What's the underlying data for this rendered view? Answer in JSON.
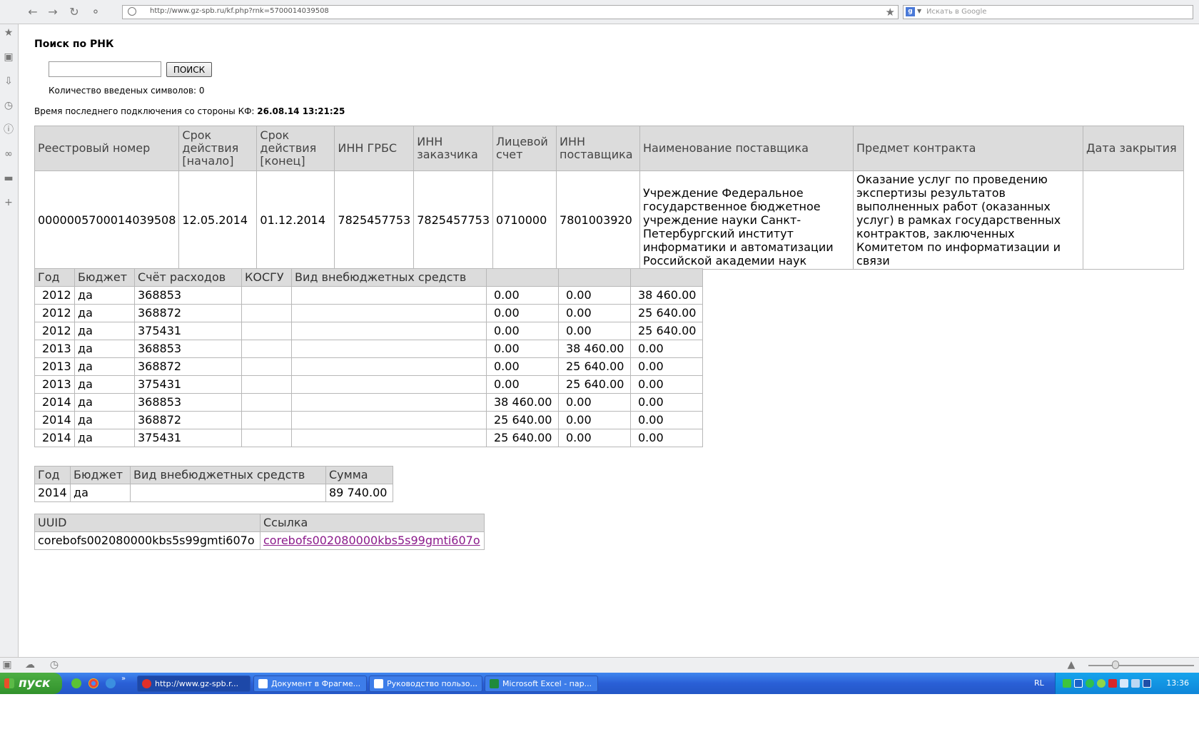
{
  "browser": {
    "url": "http://www.gz-spb.ru/kf.php?rnk=5700014039508",
    "search_placeholder": "Искать в Google",
    "google_icon_letter": "g"
  },
  "page": {
    "title": "Поиск по РНК",
    "search_button": "ПОИСК",
    "rnk_input_value": "",
    "char_count": "Количество введеных символов: 0",
    "last_connection_label": "Время последнего подключения со стороны КФ:",
    "last_connection_value": "26.08.14 13:21:25"
  },
  "contract_table": {
    "headers": [
      "Реестровый номер",
      "Срок действия [начало]",
      "Срок действия [конец]",
      "ИНН ГРБС",
      "ИНН заказчика",
      "Лицевой счет",
      "ИНН поставщика",
      "Наименование поставщика",
      "Предмет контракта",
      "Дата закрытия"
    ],
    "row": [
      "0000005700014039508",
      "12.05.2014",
      "01.12.2014",
      "7825457753",
      "7825457753",
      "0710000",
      "7801003920",
      "Учреждение Федеральное государственное бюджетное учреждение науки Санкт-Петербургский институт информатики и автоматизации Российской академии наук",
      "Оказание услуг по проведению экспертизы результатов выполненных работ (оказанных услуг) в рамках государственных контрактов, заключенных Комитетом по информатизации и связи",
      ""
    ]
  },
  "budget_table": {
    "headers": [
      "Год",
      "Бюджет",
      "Счёт расходов",
      "КОСГУ",
      "Вид внебюджетных средств",
      "",
      "",
      ""
    ],
    "rows": [
      [
        "2012",
        "да",
        "368853",
        "",
        "",
        "0.00",
        "0.00",
        "38 460.00"
      ],
      [
        "2012",
        "да",
        "368872",
        "",
        "",
        "0.00",
        "0.00",
        "25 640.00"
      ],
      [
        "2012",
        "да",
        "375431",
        "",
        "",
        "0.00",
        "0.00",
        "25 640.00"
      ],
      [
        "2013",
        "да",
        "368853",
        "",
        "",
        "0.00",
        "38 460.00",
        "0.00"
      ],
      [
        "2013",
        "да",
        "368872",
        "",
        "",
        "0.00",
        "25 640.00",
        "0.00"
      ],
      [
        "2013",
        "да",
        "375431",
        "",
        "",
        "0.00",
        "25 640.00",
        "0.00"
      ],
      [
        "2014",
        "да",
        "368853",
        "",
        "",
        "38 460.00",
        "0.00",
        "0.00"
      ],
      [
        "2014",
        "да",
        "368872",
        "",
        "",
        "25 640.00",
        "0.00",
        "0.00"
      ],
      [
        "2014",
        "да",
        "375431",
        "",
        "",
        "25 640.00",
        "0.00",
        "0.00"
      ]
    ]
  },
  "sum_table": {
    "headers": [
      "Год",
      "Бюджет",
      "Вид внебюджетных средств",
      "Сумма"
    ],
    "rows": [
      [
        "2014",
        "да",
        "",
        "89 740.00"
      ]
    ]
  },
  "uuid_table": {
    "headers": [
      "UUID",
      "Ссылка"
    ],
    "uuid": "corebofs002080000kbs5s99gmti607o",
    "link": "corebofs002080000kbs5s99gmti607o"
  },
  "taskbar": {
    "start": "пуск",
    "tasks": [
      "http://www.gz-spb.r...",
      "Документ в Фрагме...",
      "Руководство пользо...",
      "Microsoft Excel - пар..."
    ],
    "lang": "RL",
    "time": "13:36",
    "colors": {
      "task_bar": "#2a5fd6",
      "start": "#3a9a33",
      "tray": "#0f86d9"
    }
  },
  "colors": {
    "table_header_bg": "#dcdcdc",
    "visited_link": "#8b1a8b"
  }
}
